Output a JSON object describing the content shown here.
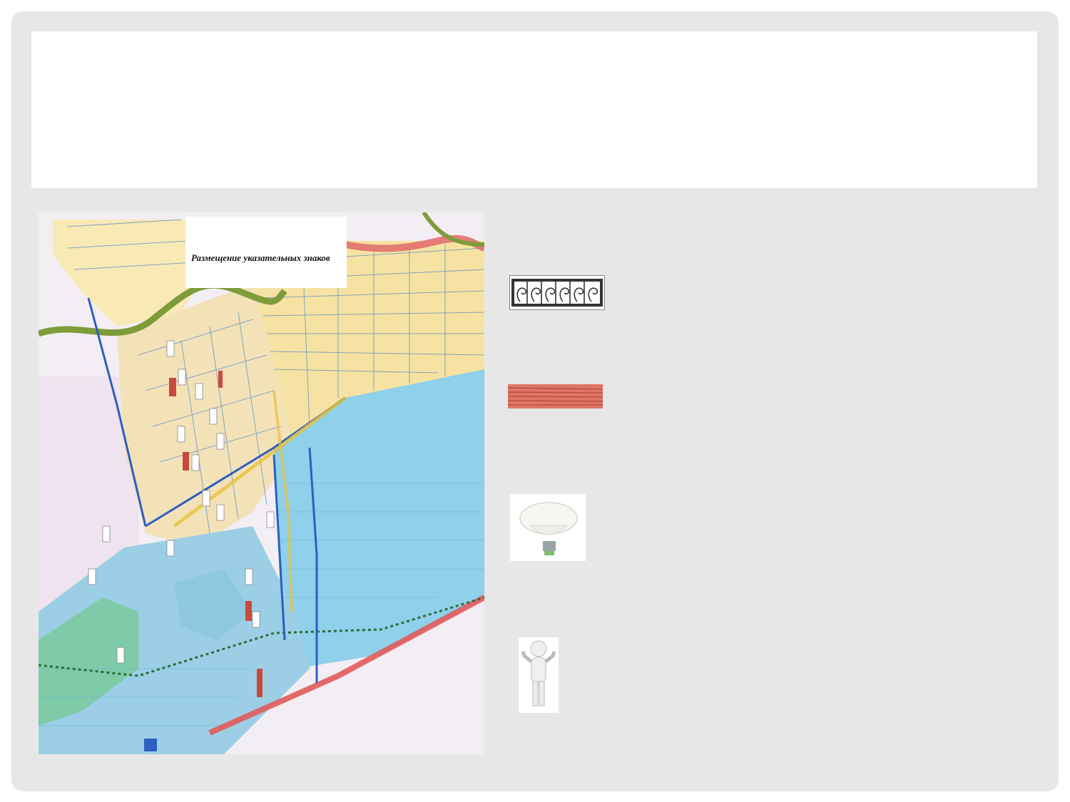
{
  "slide": {
    "title": "",
    "background": "#e7e7e7"
  },
  "map": {
    "caption": "Размещение указательных знаков",
    "colors": {
      "water": "#7fc3e3",
      "residential": "#f6e3a3",
      "road_red": "#e15a5a",
      "greenbelt": "#7e9c3a",
      "blue_road": "#2d5fbf",
      "park": "#7fd1a4",
      "sign": "#ffffff",
      "sign_red": "#c94a3d"
    },
    "icons": [
      "sign-post-icon",
      "red-sign-icon",
      "blue-square-icon"
    ]
  },
  "legend": {
    "items": [
      {
        "icon": "fence-icon",
        "label": ""
      },
      {
        "icon": "red-band-icon",
        "label": ""
      },
      {
        "icon": "lamp-icon",
        "label": ""
      },
      {
        "icon": "person-icon",
        "label": ""
      }
    ]
  }
}
